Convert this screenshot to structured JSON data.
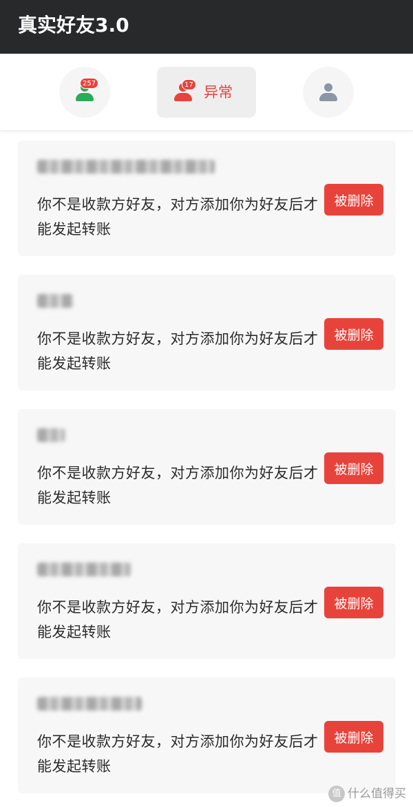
{
  "app": {
    "title": "真实好友3.0"
  },
  "tabs": [
    {
      "name": "friends",
      "badge": "257",
      "icon": "person-icon",
      "color": "#2bab5a"
    },
    {
      "name": "abnormal",
      "badge": "17",
      "label": "异常",
      "icon": "person-icon",
      "color": "#e8433b"
    },
    {
      "name": "other",
      "icon": "person-icon",
      "color": "#8a96a3"
    }
  ],
  "cards": [
    {
      "message": "你不是收款方好友，对方添加你为好友后才能发起转账",
      "action_label": "被删除"
    },
    {
      "message": "你不是收款方好友，对方添加你为好友后才能发起转账",
      "action_label": "被删除"
    },
    {
      "message": "你不是收款方好友，对方添加你为好友后才能发起转账",
      "action_label": "被删除"
    },
    {
      "message": "你不是收款方好友，对方添加你为好友后才能发起转账",
      "action_label": "被删除"
    },
    {
      "message": "你不是收款方好友，对方添加你为好友后才能发起转账",
      "action_label": "被删除"
    }
  ],
  "watermark": {
    "icon": "值",
    "text": "什么值得买"
  },
  "colors": {
    "titlebar": "#27292b",
    "accent": "#e8433b",
    "card_bg": "#f7f7f7"
  }
}
